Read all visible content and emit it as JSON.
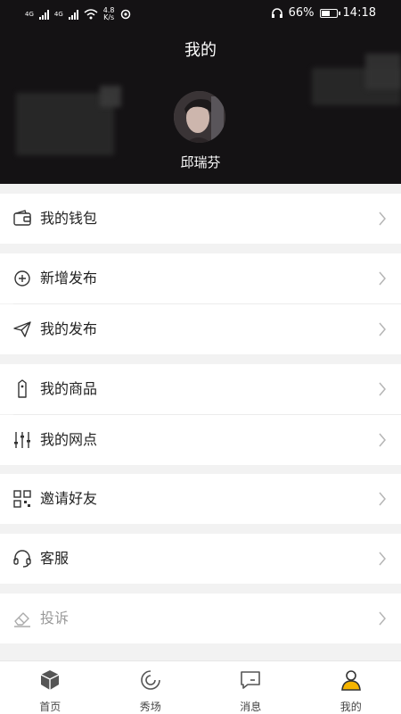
{
  "status_bar": {
    "network_1": "4G",
    "network_2": "4G",
    "speed_value": "4.8",
    "speed_unit": "K/s",
    "battery": "66%",
    "battery_level": 0.66,
    "time": "14:18"
  },
  "header": {
    "title": "我的",
    "username": "邱瑞芬"
  },
  "menu": {
    "wallet": "我的钱包",
    "new_post": "新增发布",
    "my_posts": "我的发布",
    "my_goods": "我的商品",
    "my_outlets": "我的网点",
    "invite": "邀请好友",
    "service": "客服",
    "complaint": "投诉"
  },
  "tabbar": {
    "home": "首页",
    "show": "秀场",
    "messages": "消息",
    "mine": "我的"
  },
  "colors": {
    "header_bg": "#141214",
    "active_tab": "#f5b400",
    "text": "#222222"
  }
}
